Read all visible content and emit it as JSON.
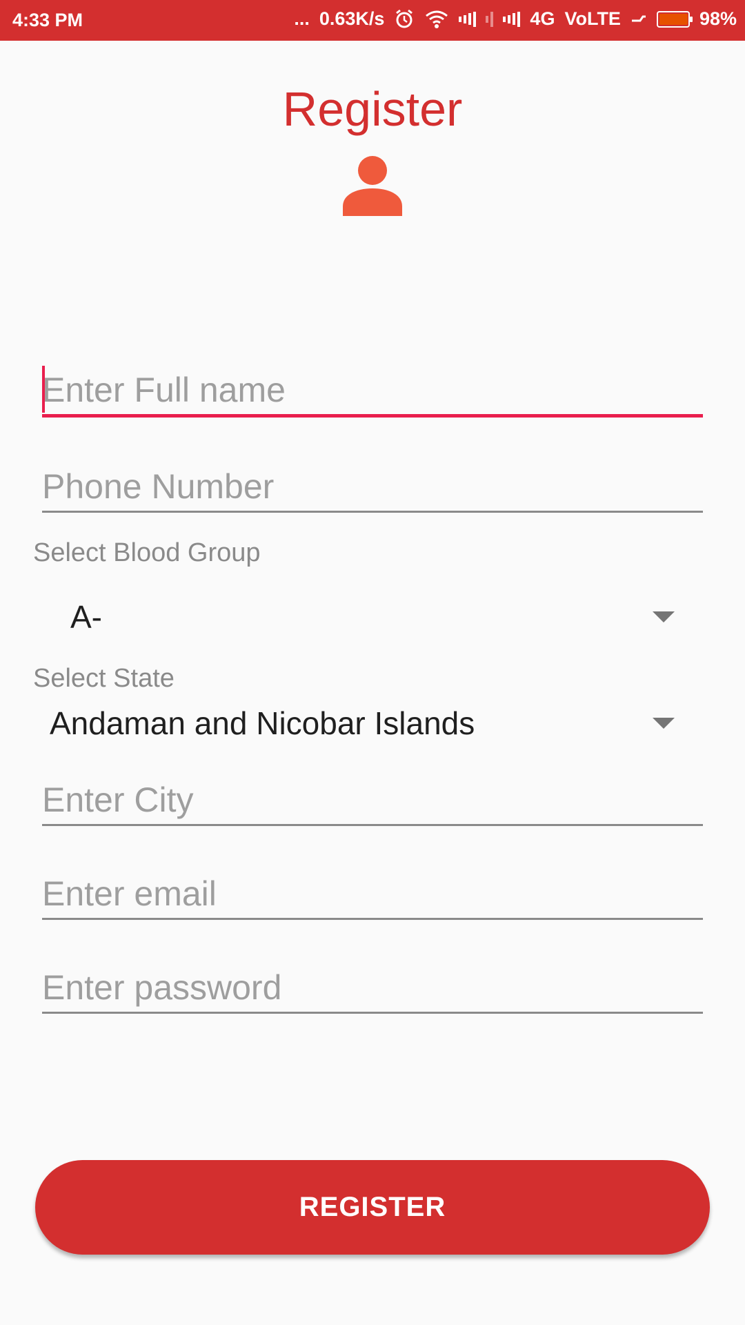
{
  "status_bar": {
    "time": "4:33 PM",
    "dots": "...",
    "net_speed": "0.63K/s",
    "network_type": "4G",
    "volte": "VoLTE",
    "battery": "98%"
  },
  "header": {
    "title": "Register",
    "icon": "person-icon"
  },
  "form": {
    "full_name_placeholder": "Enter Full name",
    "phone_placeholder": "Phone Number",
    "blood_group_label": "Select Blood Group",
    "blood_group_value": "A-",
    "state_label": "Select State",
    "state_value": "Andaman and Nicobar Islands",
    "city_placeholder": "Enter City",
    "email_placeholder": "Enter email",
    "password_placeholder": "Enter password"
  },
  "actions": {
    "register_label": "REGISTER"
  },
  "colors": {
    "primary": "#d32f2f",
    "accent": "#e91e4d",
    "avatar": "#ef5a3c",
    "background": "#fafafa"
  }
}
